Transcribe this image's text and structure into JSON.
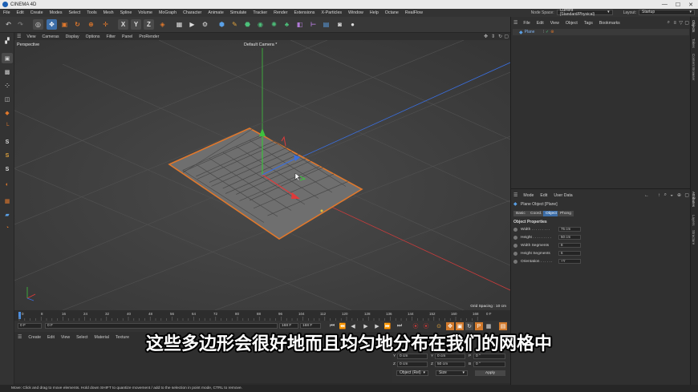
{
  "window": {
    "title": "CINEMA 4D",
    "controls": [
      "—",
      "☐",
      "✕"
    ]
  },
  "menubar": {
    "items": [
      "File",
      "Edit",
      "Create",
      "Modes",
      "Select",
      "Tools",
      "Mesh",
      "Spline",
      "Volume",
      "MoGraph",
      "Character",
      "Animate",
      "Simulate",
      "Tracker",
      "Render",
      "Extensions",
      "X-Particles",
      "Window",
      "Help",
      "Octane",
      "RealFlow"
    ],
    "node_space_label": "Node Space:",
    "node_space_value": "Current (Standard/Physical)",
    "layout_label": "Layout:",
    "layout_value": "Startup"
  },
  "viewport": {
    "menu": [
      "View",
      "Cameras",
      "Display",
      "Options",
      "Filter",
      "Panel",
      "ProRender"
    ],
    "view_name": "Perspective",
    "camera_name": "Default Camera *",
    "grid_spacing": "Grid Spacing : 10 cm"
  },
  "timeline": {
    "ticks": [
      "0",
      "8",
      "16",
      "24",
      "32",
      "40",
      "48",
      "56",
      "64",
      "72",
      "80",
      "88",
      "96",
      "104",
      "112",
      "120",
      "128",
      "136",
      "144",
      "152",
      "160",
      "168"
    ],
    "end_label": "0 F"
  },
  "transport": {
    "current_frame": "0 F",
    "start_frame": "0 F",
    "end_frame": "168 F",
    "end_frame2": "168 F"
  },
  "material": {
    "menu": [
      "Create",
      "Edit",
      "View",
      "Select",
      "Material",
      "Texture"
    ]
  },
  "coordinates": {
    "rows": [
      {
        "a_label": "Y",
        "a_val": "0 cm",
        "b_label": "Y",
        "b_val": "0 cm",
        "c_label": "P",
        "c_val": "0 °"
      },
      {
        "a_label": "Z",
        "a_val": "0 cm",
        "b_label": "Z",
        "b_val": "50 cm",
        "c_label": "B",
        "c_val": "0 °"
      }
    ],
    "mode_value": "Object (Rel)",
    "size_value": "Size",
    "apply_label": "Apply"
  },
  "object_manager": {
    "menu": [
      "File",
      "Edit",
      "View",
      "Object",
      "Tags",
      "Bookmarks"
    ],
    "objects": [
      {
        "name": "Plane"
      }
    ]
  },
  "attribute_manager": {
    "menu": [
      "Mode",
      "Edit",
      "User Data"
    ],
    "object_title": "Plane Object [Plane]",
    "tabs": [
      "Basic",
      "Coord.",
      "Object",
      "Phong"
    ],
    "active_tab": "Object",
    "section_title": "Object Properties",
    "properties": [
      {
        "label": "Width . . . . . . . . .",
        "value": "75 cm"
      },
      {
        "label": "Height . . . . . . . . .",
        "value": "50 cm"
      },
      {
        "label": "Width Segments",
        "value": "8"
      },
      {
        "label": "Height Segments",
        "value": "6"
      },
      {
        "label": "Orientation . . . . . .",
        "value": "+Y"
      }
    ]
  },
  "side_tabs": [
    "Objects",
    "Takes",
    "Content Browser",
    "Attributes",
    "Layers",
    "Structure"
  ],
  "status": {
    "text": "Move: Click and drag to move elements. Hold down SHIFT to quantize movement / add to the selection in point mode, CTRL to remove."
  },
  "subtitle": {
    "text": "这些多边形会很好地而且均匀地分布在我们的网格中"
  },
  "colors": {
    "accent_orange": "#e0782c",
    "axis_red": "#e03a3a",
    "axis_green": "#3ec23e",
    "axis_blue": "#3a6fe0",
    "selection_blue": "#3d6ea8"
  }
}
